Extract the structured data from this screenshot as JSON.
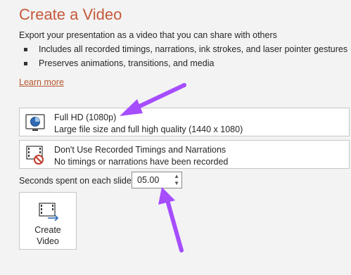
{
  "panel": {
    "title": "Create a Video",
    "description": "Export your presentation as a video that you can share with others",
    "bullets": [
      "Includes all recorded timings, narrations, ink strokes, and laser pointer gestures",
      "Preserves animations, transitions, and media"
    ],
    "learn_more": "Learn more"
  },
  "quality_dropdown": {
    "title": "Full HD (1080p)",
    "subtitle": "Large file size and full high quality (1440 x 1080)",
    "icon": "monitor-quality-icon"
  },
  "timings_dropdown": {
    "title": "Don't Use Recorded Timings and Narrations",
    "subtitle": "No timings or narrations have been recorded",
    "icon": "no-timings-icon"
  },
  "seconds": {
    "label": "Seconds spent on each slide:",
    "value": "05.00"
  },
  "create_button": {
    "line1": "Create",
    "line2": "Video",
    "icon": "create-video-icon"
  },
  "colors": {
    "accent": "#c4593a",
    "annotation_arrow": "#a64dff"
  }
}
